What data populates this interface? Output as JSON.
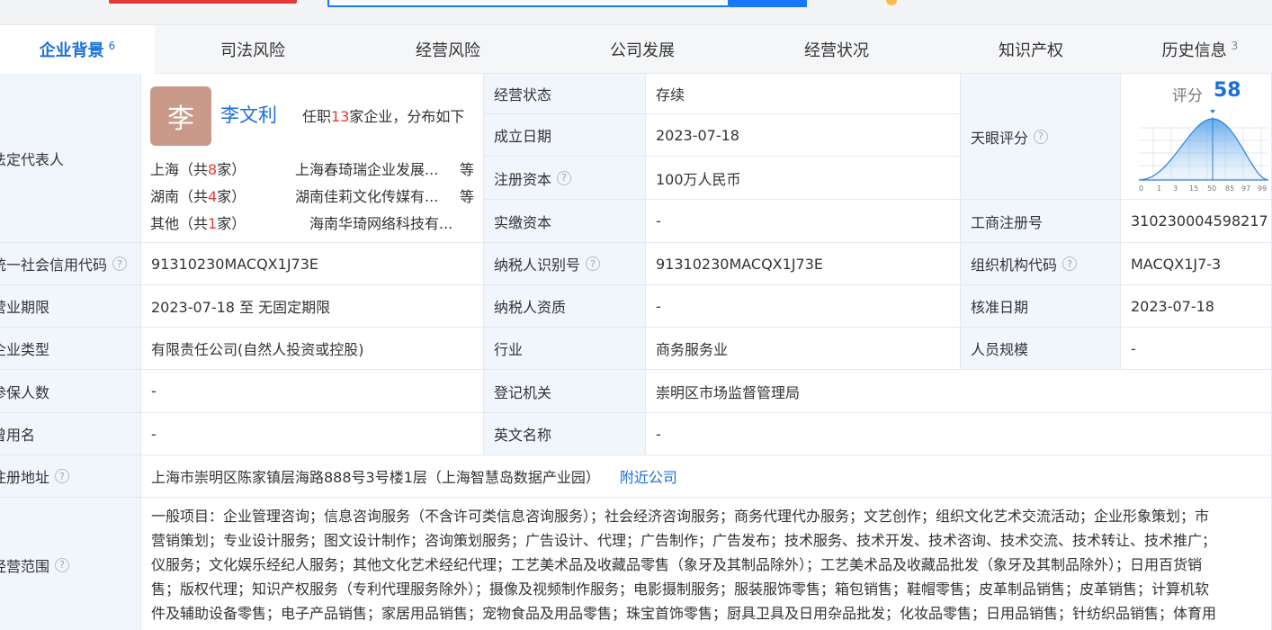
{
  "tabs": [
    {
      "label": "企业背景",
      "count": "6"
    },
    {
      "label": "司法风险"
    },
    {
      "label": "经营风险"
    },
    {
      "label": "公司发展"
    },
    {
      "label": "经营状况"
    },
    {
      "label": "知识产权"
    },
    {
      "label": "历史信息",
      "count": "3"
    }
  ],
  "legal_rep": {
    "label": "法定代表人",
    "avatar_char": "李",
    "name": "李文利",
    "summary_prefix": "任职",
    "summary_count": "13",
    "summary_suffix": "家企业，分布如下",
    "distribution": [
      {
        "region_prefix": "上海（共",
        "count": "8",
        "region_suffix": "家）",
        "company": "上海春琦瑞企业发展...",
        "more": "等"
      },
      {
        "region_prefix": "湖南（共",
        "count": "4",
        "region_suffix": "家）",
        "company": "湖南佳莉文化传媒有...",
        "more": "等"
      },
      {
        "region_prefix": "其他（共",
        "count": "1",
        "region_suffix": "家）",
        "company": "海南华琦网络科技有...",
        "more": ""
      }
    ]
  },
  "middle_fields": {
    "status_label": "经营状态",
    "status_value": "存续",
    "founded_label": "成立日期",
    "founded_value": "2023-07-18",
    "reg_capital_label": "注册资本",
    "reg_capital_value": "100万人民币",
    "paid_capital_label": "实缴资本",
    "paid_capital_value": "-"
  },
  "score": {
    "label": "天眼评分",
    "small_label": "评分",
    "value": "58",
    "axis_ticks": [
      "0",
      "1",
      "3",
      "15",
      "50",
      "85",
      "97",
      "99"
    ]
  },
  "reg_no": {
    "label": "工商注册号",
    "value": "310230004598217"
  },
  "rows": {
    "credit_code_label": "统一社会信用代码",
    "credit_code_value": "91310230MACQX1J73E",
    "taxpayer_id_label": "纳税人识别号",
    "taxpayer_id_value": "91310230MACQX1J73E",
    "org_code_label": "组织机构代码",
    "org_code_value": "MACQX1J7-3",
    "term_label": "营业期限",
    "term_value": "2023-07-18 至 无固定期限",
    "taxpayer_qual_label": "纳税人资质",
    "taxpayer_qual_value": "-",
    "approve_date_label": "核准日期",
    "approve_date_value": "2023-07-18",
    "type_label": "企业类型",
    "type_value": "有限责任公司(自然人投资或控股)",
    "industry_label": "行业",
    "industry_value": "商务服务业",
    "staff_label": "人员规模",
    "staff_value": "-",
    "insured_label": "参保人数",
    "insured_value": "-",
    "authority_label": "登记机关",
    "authority_value": "崇明区市场监督管理局",
    "former_name_label": "曾用名",
    "former_name_value": "-",
    "en_name_label": "英文名称",
    "en_name_value": "-",
    "address_label": "注册地址",
    "address_value": "上海市崇明区陈家镇层海路888号3号楼1层（上海智慧岛数据产业园）",
    "nearby_link": "附近公司",
    "scope_label": "经营范围"
  },
  "scope_lines": [
    "一般项目：企业管理咨询；信息咨询服务（不含许可类信息咨询服务）；社会经济咨询服务；商务代理代办服务；文艺创作；组织文化艺术交流活动；企业形象策划；市",
    "营销策划；专业设计服务；图文设计制作；咨询策划服务；广告设计、代理；广告制作；广告发布；技术服务、技术开发、技术咨询、技术交流、技术转让、技术推广；",
    "仪服务；文化娱乐经纪人服务；其他文化艺术经纪代理；工艺美术品及收藏品零售（象牙及其制品除外）；工艺美术品及收藏品批发（象牙及其制品除外）；日用百货销",
    "售；版权代理；知识产权服务（专利代理服务除外）；摄像及视频制作服务；电影摄制服务；服装服饰零售；箱包销售；鞋帽零售；皮革制品销售；皮革销售；计算机软",
    "件及辅助设备零售；电子产品销售；家居用品销售；宠物食品及用品零售；珠宝首饰零售；厨具卫具及日用杂品批发；化妆品零售；日用品销售；针纺织品销售；体育用"
  ],
  "colors": {
    "accent": "#1b6fd8",
    "label_bg": "#f1f6fd",
    "highlight": "#e53935",
    "avatar": "#c99a89"
  }
}
